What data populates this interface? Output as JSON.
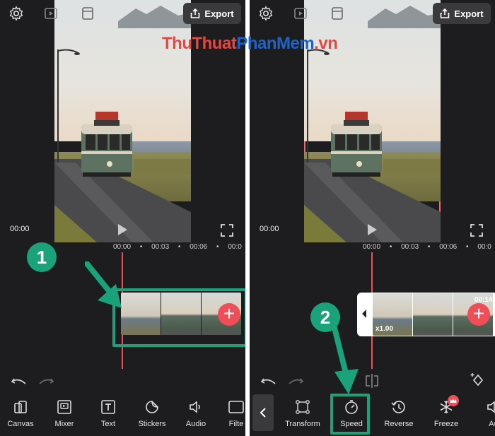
{
  "header": {
    "export_label": "Export"
  },
  "watermark": {
    "part1": "ThuThuat",
    "part2": "PhanMem",
    "part3": ".vn"
  },
  "left": {
    "preview_time": "00:00",
    "ruler": [
      "00:00",
      "•",
      "00:03",
      "•",
      "00:06",
      "•",
      "00:0"
    ],
    "step_badge": "1",
    "toolbar": [
      {
        "label": "Canvas",
        "icon": "canvas-icon"
      },
      {
        "label": "Mixer",
        "icon": "mixer-icon"
      },
      {
        "label": "Text",
        "icon": "text-icon"
      },
      {
        "label": "Stickers",
        "icon": "stickers-icon"
      },
      {
        "label": "Audio",
        "icon": "audio-icon"
      },
      {
        "label": "Filte",
        "icon": "filter-icon"
      }
    ]
  },
  "right": {
    "preview_time": "00:00",
    "ruler": [
      "00:00",
      "•",
      "00:03",
      "•",
      "00:06",
      "•",
      "00:0"
    ],
    "clip_speed": "x1.00",
    "clip_duration": "00:14",
    "step_badge": "2",
    "toolbar": [
      {
        "label": "Transform",
        "icon": "transform-icon"
      },
      {
        "label": "Speed",
        "icon": "speed-icon"
      },
      {
        "label": "Reverse",
        "icon": "reverse-icon"
      },
      {
        "label": "Freeze",
        "icon": "freeze-icon"
      },
      {
        "label": "Au",
        "icon": "audio-icon"
      }
    ]
  },
  "colors": {
    "accent": "#ef4d57",
    "highlight": "#1aa37a",
    "background": "#1d1d1f"
  }
}
